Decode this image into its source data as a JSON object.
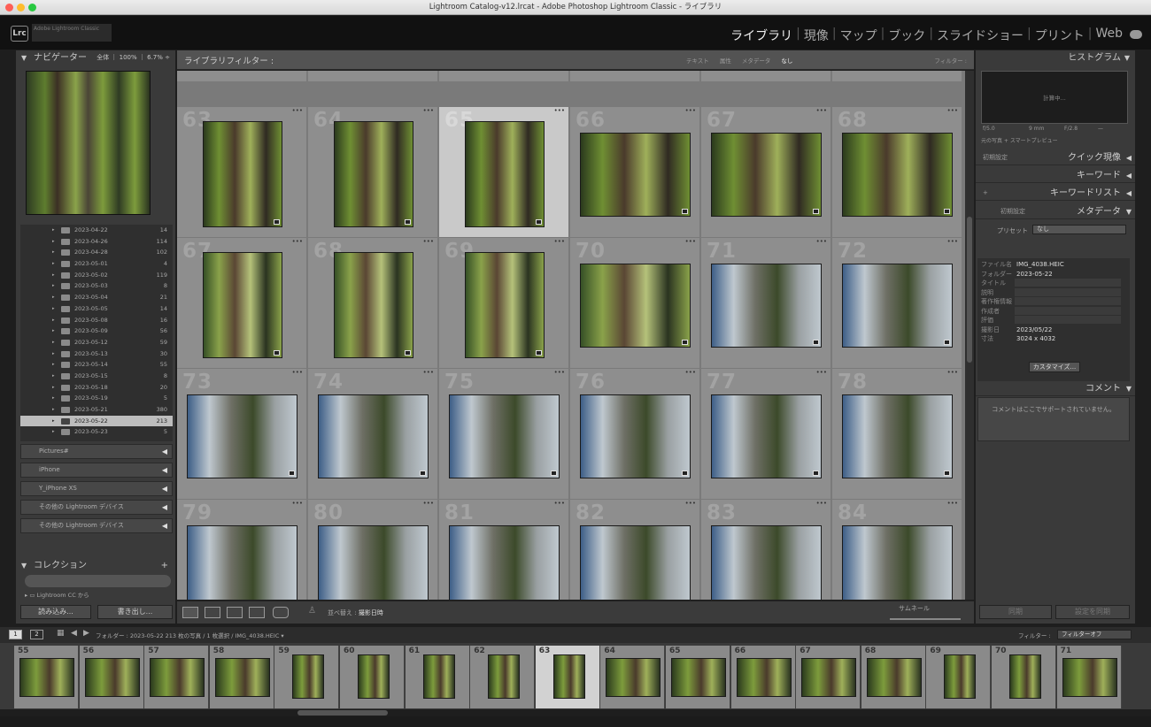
{
  "window": {
    "title": "Lightroom Catalog-v12.lrcat - Adobe Photoshop Lightroom Classic - ライブラリ"
  },
  "app": {
    "logo": "Lrc",
    "identity": "Adobe Lightroom Classic"
  },
  "modules": [
    {
      "label": "ライブラリ",
      "active": true
    },
    {
      "label": "現像",
      "active": false
    },
    {
      "label": "マップ",
      "active": false
    },
    {
      "label": "ブック",
      "active": false
    },
    {
      "label": "スライドショー",
      "active": false
    },
    {
      "label": "プリント",
      "active": false
    },
    {
      "label": "Web",
      "active": false
    }
  ],
  "navigator": {
    "title": "ナビゲーター",
    "zoom_options": "全体 ｜ 100% ｜ 6.7% ÷"
  },
  "folders": [
    {
      "name": "2023-04-22",
      "count": "14"
    },
    {
      "name": "2023-04-26",
      "count": "114"
    },
    {
      "name": "2023-04-28",
      "count": "102"
    },
    {
      "name": "2023-05-01",
      "count": "4"
    },
    {
      "name": "2023-05-02",
      "count": "119"
    },
    {
      "name": "2023-05-03",
      "count": "8"
    },
    {
      "name": "2023-05-04",
      "count": "21"
    },
    {
      "name": "2023-05-05",
      "count": "14"
    },
    {
      "name": "2023-05-08",
      "count": "16"
    },
    {
      "name": "2023-05-09",
      "count": "56"
    },
    {
      "name": "2023-05-12",
      "count": "59"
    },
    {
      "name": "2023-05-13",
      "count": "30"
    },
    {
      "name": "2023-05-14",
      "count": "55"
    },
    {
      "name": "2023-05-15",
      "count": "8"
    },
    {
      "name": "2023-05-18",
      "count": "20"
    },
    {
      "name": "2023-05-19",
      "count": "5"
    },
    {
      "name": "2023-05-21",
      "count": "380"
    },
    {
      "name": "2023-05-22",
      "count": "213",
      "selected": true
    },
    {
      "name": "2023-05-23",
      "count": "5"
    }
  ],
  "devices": [
    "Pictures#",
    "iPhone",
    "Y_iPhone XS",
    "その他の Lightroom デバイス",
    "その他の Lightroom デバイス"
  ],
  "collections": {
    "title": "コレクション",
    "item": "Lightroom CC から"
  },
  "left_buttons": {
    "import": "読み込み...",
    "export": "書き出し..."
  },
  "filter_bar": {
    "title": "ライブラリフィルター :",
    "options": [
      "テキスト",
      "属性",
      "メタデータ",
      "なし"
    ],
    "active": "なし",
    "preset": "フィルター :"
  },
  "grid": {
    "cells": [
      {
        "num": "",
        "row": -1
      },
      {
        "num": "63"
      },
      {
        "num": "64"
      },
      {
        "num": "65"
      },
      {
        "num": "66"
      },
      {
        "num": "67"
      },
      {
        "num": "68"
      },
      {
        "num": "67"
      },
      {
        "num": "68"
      },
      {
        "num": "69"
      },
      {
        "num": "70"
      },
      {
        "num": "71"
      },
      {
        "num": "72"
      },
      {
        "num": "73"
      },
      {
        "num": "74"
      },
      {
        "num": "75"
      },
      {
        "num": "76"
      },
      {
        "num": "77"
      },
      {
        "num": "78"
      },
      {
        "num": "79"
      },
      {
        "num": "80"
      },
      {
        "num": "81"
      },
      {
        "num": "82"
      },
      {
        "num": "83"
      },
      {
        "num": "84"
      }
    ]
  },
  "toolbar": {
    "sort_label": "並べ替え :",
    "sort_value": "撮影日時",
    "thumbnail_label": "サムネール"
  },
  "histogram": {
    "title": "ヒストグラム",
    "status": "計算中...",
    "info": [
      "f/5.0",
      "9 mm",
      "F/2.8",
      "—"
    ],
    "smart_preview": "元の写真 + スマートプレビュー"
  },
  "quick_develop": {
    "title": "クイック現像",
    "preset": "初期設定"
  },
  "keywording": {
    "title": "キーワード"
  },
  "keyword_list": {
    "title": "キーワードリスト"
  },
  "metadata": {
    "title": "メタデータ",
    "preset_select": "初期設定",
    "preset_label": "プリセット",
    "preset_value": "なし",
    "fields": [
      {
        "label": "ファイル名",
        "value": "IMG_4038.HEIC"
      },
      {
        "label": "フォルダー",
        "value": "2023-05-22"
      },
      {
        "label": "タイトル",
        "value": ""
      },
      {
        "label": "説明",
        "value": ""
      },
      {
        "label": "著作権情報",
        "value": ""
      },
      {
        "label": "作成者",
        "value": ""
      },
      {
        "label": "評価",
        "value": ""
      },
      {
        "label": "撮影日",
        "value": "2023/05/22"
      },
      {
        "label": "寸法",
        "value": "3024 x 4032"
      }
    ],
    "customize": "カスタマイズ..."
  },
  "comments": {
    "title": "コメント",
    "text": "コメントはここでサポートされていません。"
  },
  "right_buttons": {
    "sync": "同期",
    "sync_settings": "設定を同期"
  },
  "filmstrip": {
    "info": "フォルダー : 2023-05-22  213 枚の写真 / 1 枚選択 / IMG_4038.HEIC ▾",
    "filter_label": "フィルター :",
    "filter_value": "フィルターオフ",
    "frames": [
      "55",
      "56",
      "57",
      "58",
      "59",
      "60",
      "61",
      "62",
      "63",
      "64",
      "65",
      "66",
      "67",
      "68",
      "69",
      "70",
      "71"
    ],
    "selected": "63"
  },
  "colors": {
    "accent": "#f0f0f0",
    "panel": "#3a3a3a",
    "grid": "#8e8e8e",
    "selected_cell": "#c9c9c9"
  }
}
